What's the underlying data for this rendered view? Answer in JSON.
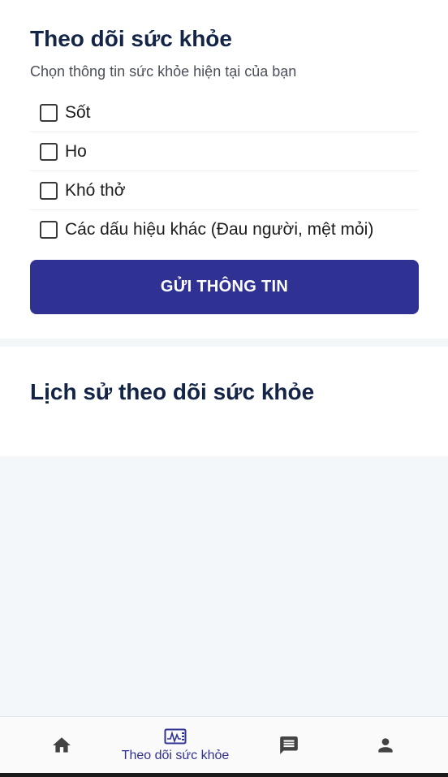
{
  "health_form": {
    "title": "Theo dõi sức khỏe",
    "subtitle": "Chọn thông tin sức khỏe hiện tại của bạn",
    "options": [
      {
        "label": "Sốt",
        "checked": false
      },
      {
        "label": "Ho",
        "checked": false
      },
      {
        "label": "Khó thở",
        "checked": false
      },
      {
        "label": "Các dấu hiệu khác (Đau người, mệt mỏi)",
        "checked": false
      }
    ],
    "submit_label": "GỬI THÔNG TIN"
  },
  "history": {
    "title": "Lịch sử theo dõi sức khỏe"
  },
  "bottom_nav": {
    "items": [
      {
        "icon": "home-icon",
        "label": ""
      },
      {
        "icon": "monitor-icon",
        "label": "Theo dõi sức khỏe",
        "active": true
      },
      {
        "icon": "message-icon",
        "label": ""
      },
      {
        "icon": "person-icon",
        "label": ""
      }
    ],
    "active_color": "#2f3193",
    "inactive_color": "#424242"
  },
  "colors": {
    "primary": "#2f3193",
    "heading": "#142447",
    "background": "#f4f7fa"
  }
}
